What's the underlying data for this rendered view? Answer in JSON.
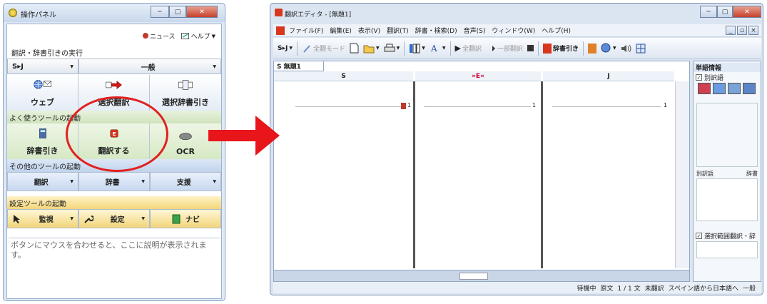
{
  "panel": {
    "title": "操作パネル",
    "news_label": "ニュース",
    "help_label": "ヘルプ",
    "help_arrow": "▼",
    "section_run": "翻訳・辞書引きの実行",
    "direction": "S▸J",
    "category": "一般",
    "dropdown_arrow": "▼",
    "buttons_main": [
      "ウェブ",
      "選択翻訳",
      "選択辞書引き"
    ],
    "section_fav": "よく使うツールの起動",
    "buttons_fav": [
      "辞書引き",
      "翻訳する",
      "OCR"
    ],
    "section_other": "その他のツールの起動",
    "buttons_other": [
      "翻訳",
      "辞書",
      "支援"
    ],
    "section_settings": "設定ツールの起動",
    "buttons_settings": [
      "監視",
      "設定",
      "ナビ"
    ],
    "description": "ボタンにマウスを合わせると、ここに説明が表示されます。"
  },
  "editor": {
    "title": "翻訳エディタ - [無題1]",
    "menu": [
      "ファイル(F)",
      "編集(E)",
      "表示(V)",
      "翻訳(T)",
      "辞書・検索(D)",
      "音声(S)",
      "ウィンドウ(W)",
      "ヘルプ(H)"
    ],
    "toolbar": {
      "direction": "S▸J",
      "mode": "全翻モード",
      "full_translate": "全翻訳",
      "part_translate": "一部翻訳",
      "dict_lookup": "辞書引き"
    },
    "tab": "S 無題1",
    "columns": {
      "source": "S",
      "middle": "»E«",
      "target": "J"
    },
    "line_numbers": [
      "1",
      "1",
      "1"
    ],
    "right_panel": {
      "title": "単語情報",
      "alt_check": "別訳語",
      "alt_label": "別訳語",
      "dict_label": "辞書",
      "range_check": "選択範囲翻訳・辞"
    },
    "status": [
      "待機中",
      "原文",
      "1 / 1 文",
      "未翻訳",
      "スペイン語から日本語へ",
      "一般"
    ],
    "mdi_buttons": [
      "_",
      "▫",
      "×"
    ]
  },
  "window_buttons": [
    "─",
    "▢",
    "✕"
  ]
}
